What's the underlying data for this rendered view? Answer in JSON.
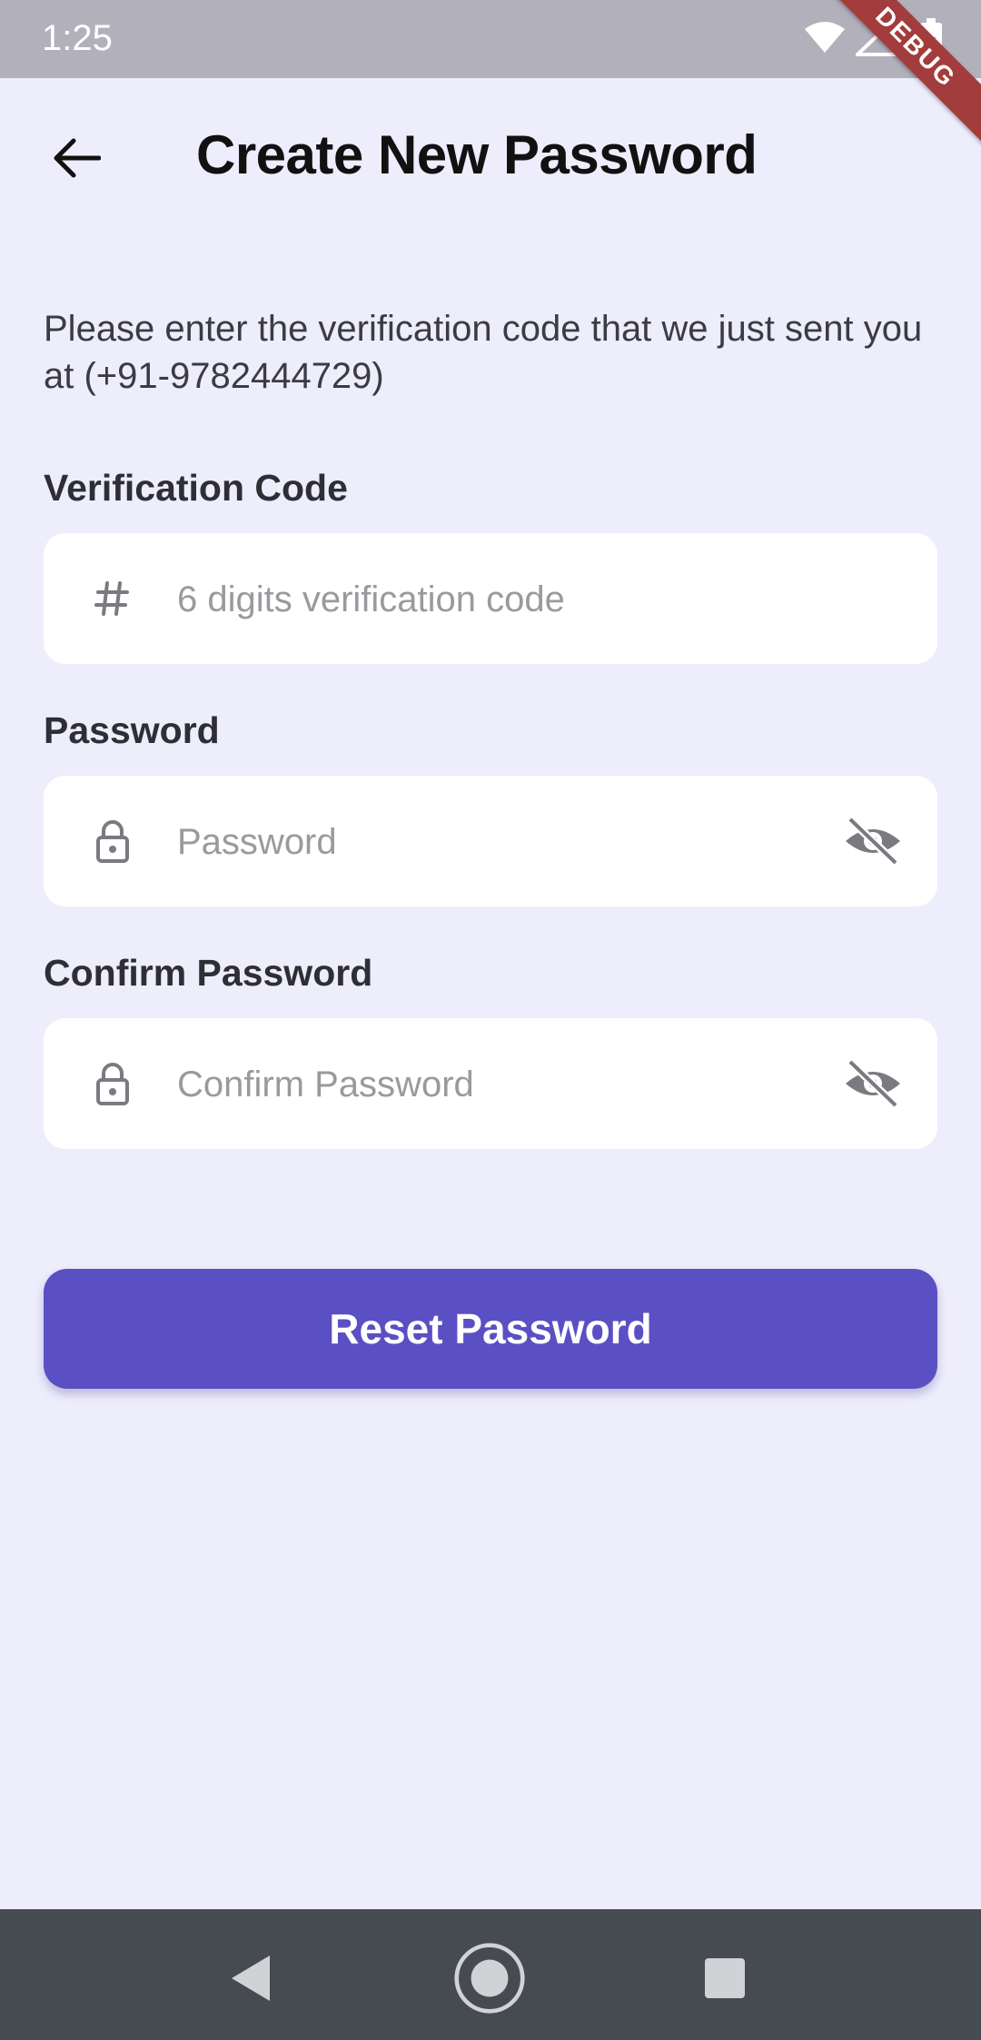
{
  "status_bar": {
    "time": "1:25",
    "battery_level": "76",
    "debug_label": "DEBUG",
    "icons": [
      "wifi-icon",
      "signal-icon",
      "battery-icon"
    ]
  },
  "header": {
    "title": "Create New Password",
    "back_icon": "arrow-left-icon"
  },
  "intro": {
    "text": "Please enter the verification code that we just sent you at (+91-9782444729)"
  },
  "form": {
    "verification": {
      "label": "Verification Code",
      "placeholder": "6 digits verification code",
      "value": "",
      "icon": "hash-icon"
    },
    "password": {
      "label": "Password",
      "placeholder": "Password",
      "value": "",
      "icon": "lock-icon",
      "toggle_icon": "eye-off-icon"
    },
    "confirm_password": {
      "label": "Confirm Password",
      "placeholder": "Confirm Password",
      "value": "",
      "icon": "lock-icon",
      "toggle_icon": "eye-off-icon"
    }
  },
  "actions": {
    "reset_label": "Reset Password"
  },
  "nav_bar": {
    "buttons": [
      "back-triangle-icon",
      "home-circle-icon",
      "recents-square-icon"
    ]
  },
  "colors": {
    "background": "#eeedfb",
    "primary": "#5b4fc4",
    "status_bar": "#b1b0bb",
    "nav_bar": "#464b51",
    "field_bg": "#ffffff"
  }
}
